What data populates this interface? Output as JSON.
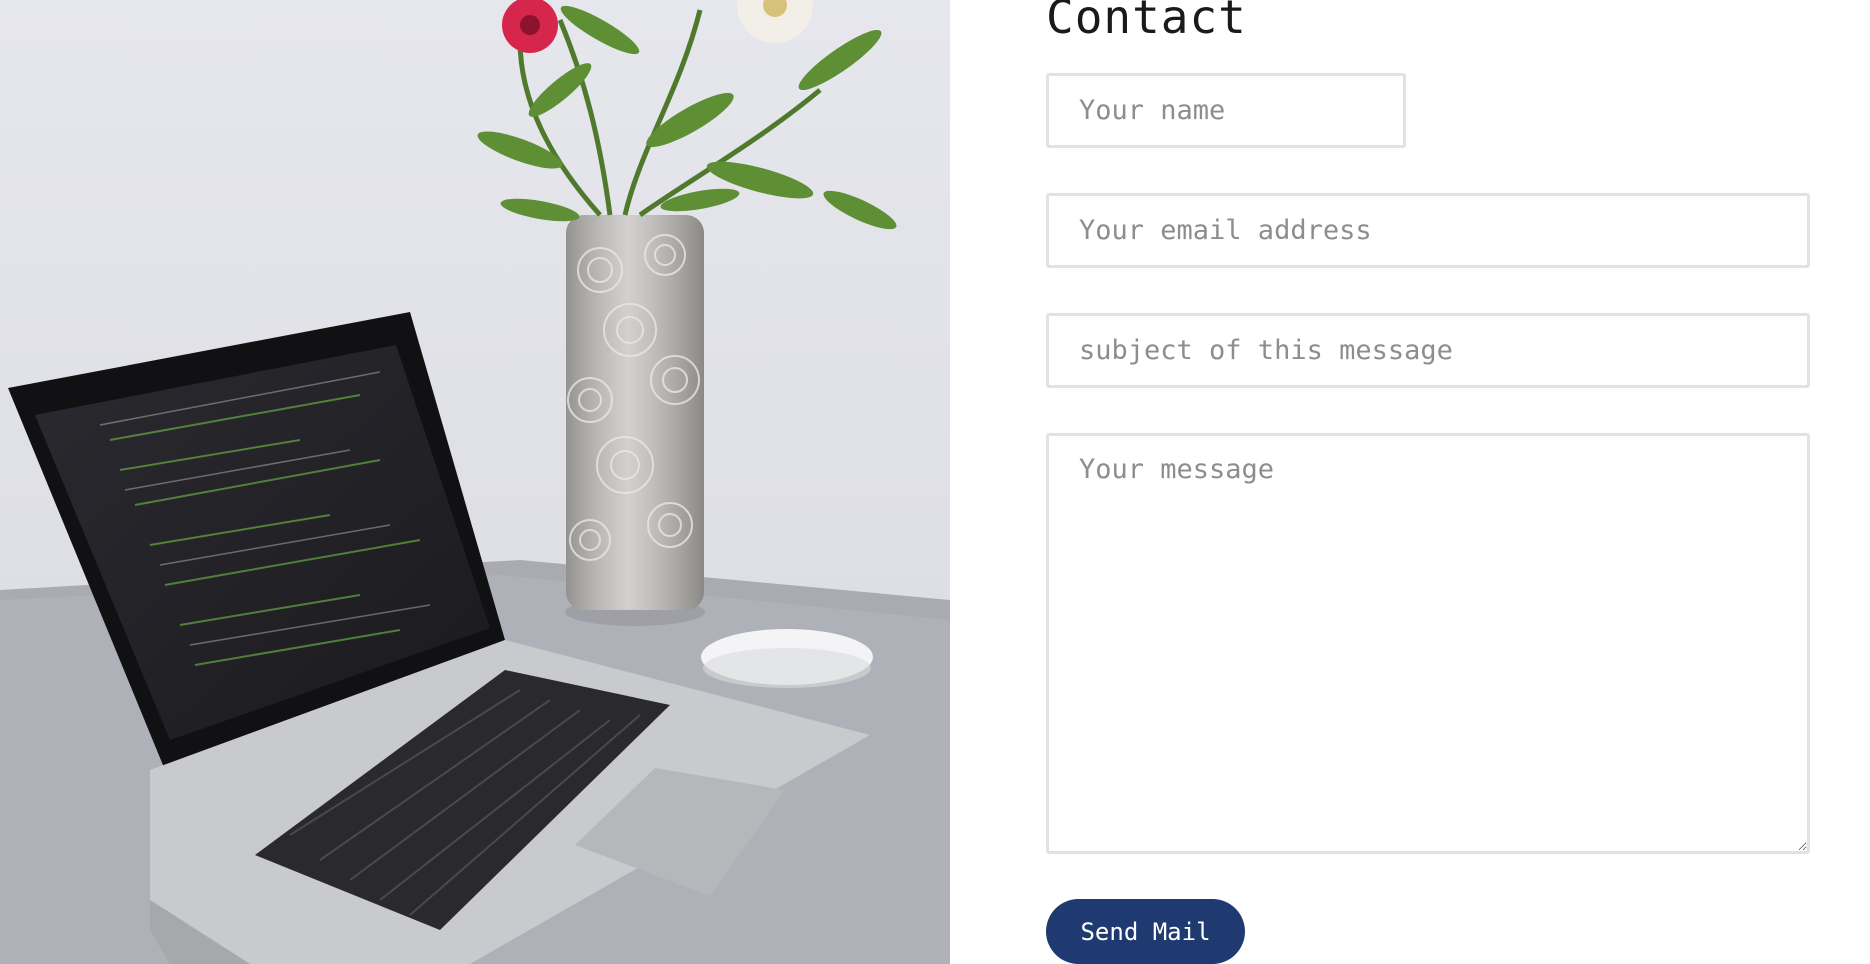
{
  "contact": {
    "title": "Contact",
    "name_placeholder": "Your name",
    "email_placeholder": "Your email address",
    "subject_placeholder": "subject of this message",
    "message_placeholder": "Your message",
    "send_label": "Send Mail"
  },
  "colors": {
    "button": "#1f3a70",
    "field_border": "#e2e2e2",
    "placeholder": "#8d8d8d"
  }
}
